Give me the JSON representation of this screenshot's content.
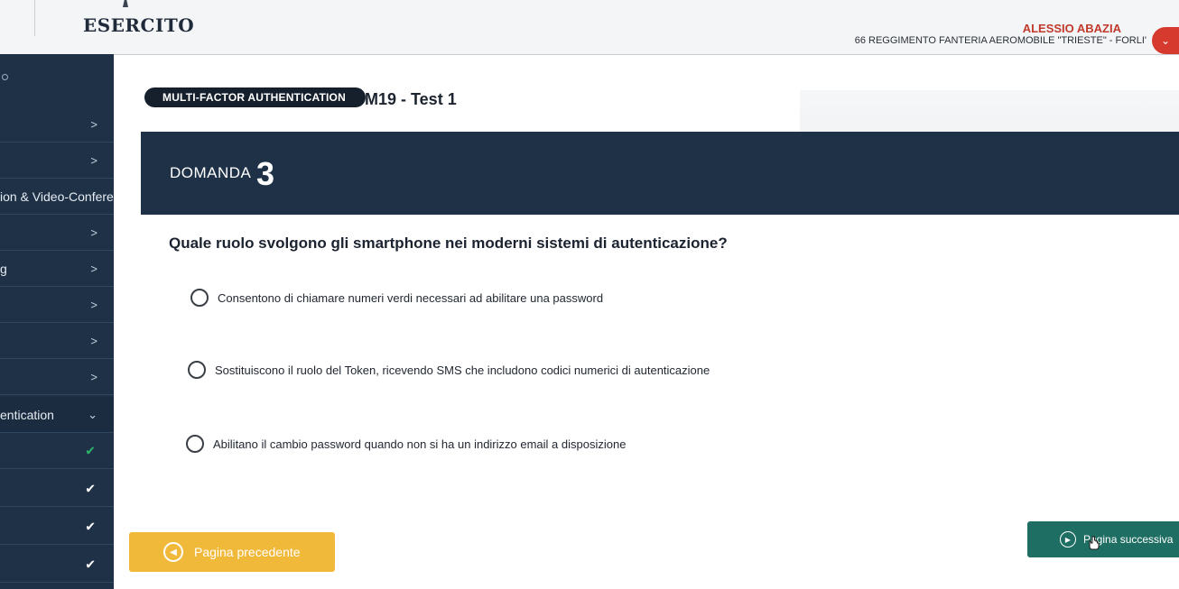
{
  "header": {
    "brand": "ESERCITO",
    "user_name": "ALESSIO ABAZIA",
    "user_unit": "66 REGGIMENTO FANTERIA AEROMOBILE \"TRIESTE\" - FORLI'",
    "menu_icon": "chevron-down-icon"
  },
  "sidebar": {
    "items": [
      {
        "label": "",
        "chevron": ">"
      },
      {
        "label": "",
        "chevron": ">"
      },
      {
        "label": "ion & Video-Conferer",
        "chevron": ""
      },
      {
        "label": "",
        "chevron": ">"
      },
      {
        "label": "g",
        "chevron": ">"
      },
      {
        "label": "",
        "chevron": ">"
      },
      {
        "label": "",
        "chevron": ">"
      },
      {
        "label": "",
        "chevron": ">"
      },
      {
        "label": "entication",
        "chevron": "⌄"
      }
    ],
    "lessons": [
      {
        "status": "✔",
        "color": "#2ab36a"
      },
      {
        "status": "✔",
        "color": "#ffffff"
      },
      {
        "status": "✔",
        "color": "#ffffff"
      },
      {
        "status": "✔",
        "color": "#ffffff"
      }
    ]
  },
  "main": {
    "module_pill": "MULTI-FACTOR AUTHENTICATION",
    "test_title": "M19 - Test 1",
    "domanda_label": "DOMANDA",
    "domanda_number": "3",
    "question": "Quale ruolo svolgono gli smartphone nei moderni sistemi di autenticazione?",
    "answers": [
      "Consentono di chiamare numeri verdi necessari ad abilitare una password",
      "Sostituiscono il ruolo del Token, ricevendo SMS che includono codici numerici di autenticazione",
      "Abilitano il cambio password quando non si ha un indirizzo email a disposizione"
    ],
    "prev_button": "Pagina precedente",
    "next_button": "Pagina successiva"
  },
  "colors": {
    "navy": "#1e3147",
    "accent_red": "#c0392b",
    "prev_yellow": "#f0b93a",
    "next_teal": "#1f6e63",
    "check_green": "#2ab36a"
  }
}
